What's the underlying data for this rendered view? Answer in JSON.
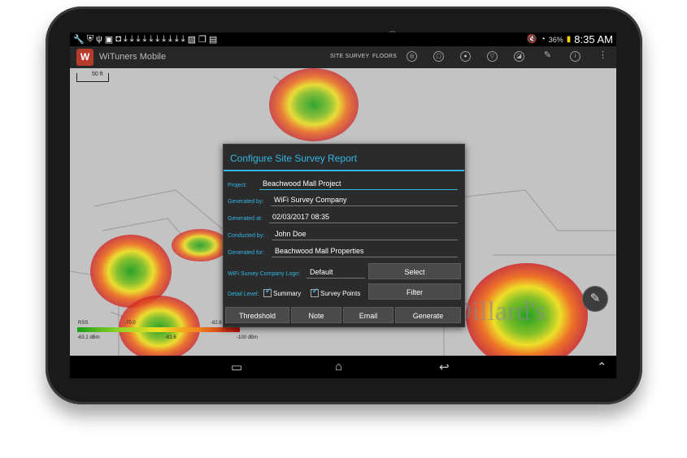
{
  "status_bar": {
    "left_icons": [
      "wrench-icon",
      "shield-icon",
      "usb-icon",
      "sd-card-icon",
      "screenshot-icon",
      "download-icon",
      "download-icon",
      "download-icon",
      "download-icon",
      "download-icon",
      "download-icon",
      "download-icon",
      "download-icon",
      "download-icon",
      "download-icon",
      "image-icon",
      "copy-icon",
      "briefcase-icon"
    ],
    "battery": "36%",
    "time": "8:35 AM"
  },
  "action_bar": {
    "app_title": "WiTuners Mobile",
    "site_survey_label": "SITE SURVEY",
    "floors_label": "FLOORS"
  },
  "map": {
    "scale_label": "50 ft",
    "legend": {
      "label": "RSS",
      "tick_left": "-63.1 dBm",
      "tick_mid1": "-70.0",
      "tick_mid2": "-82.6",
      "tick_mid3": "-61.6",
      "tick_right": "-100 dBm"
    }
  },
  "dialog": {
    "title": "Configure Site Survey Report",
    "project_label": "Project:",
    "project_value": "Beachwood Mall Project",
    "generated_by_label": "Generated by:",
    "generated_by_value": "WiFi Survey Company",
    "generated_at_label": "Generated at:",
    "generated_at_value": "02/03/2017 08:35",
    "conducted_by_label": "Conducted by:",
    "conducted_by_value": "John Doe",
    "generated_for_label": "Generated for:",
    "generated_for_value": "Beachwood Mall Properties",
    "logo_label": "WiFi Survey Company Logo:",
    "logo_value": "Default",
    "select_label": "Select",
    "detail_label": "Detail Level:",
    "summary_label": "Summary",
    "survey_points_label": "Survey Points",
    "filter_label": "Filter",
    "buttons": {
      "threshold": "Thredshold",
      "note": "Note",
      "email": "Email",
      "generate": "Generate"
    }
  },
  "colors": {
    "accent": "#33b5e5",
    "dialog_bg": "#2b2b2b",
    "button_bg": "#4a4a4a"
  }
}
